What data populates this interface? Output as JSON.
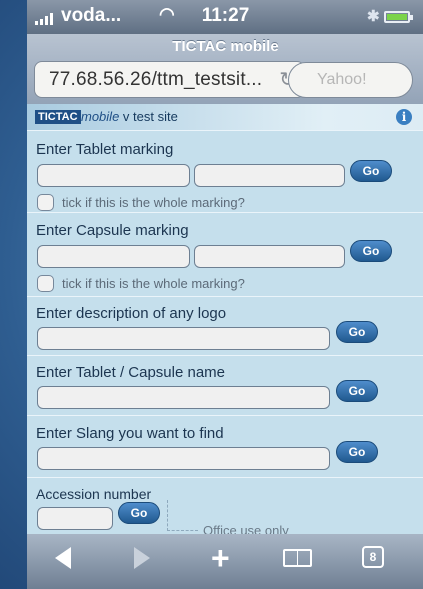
{
  "status_bar": {
    "carrier": "voda...",
    "time": "11:27"
  },
  "browser": {
    "page_title": "TICTAC mobile",
    "url": "77.68.56.26/ttm_testsit...",
    "search_placeholder": "Yahoo!"
  },
  "site_header": {
    "logo": "TICTAC",
    "tagline_em": "mobile",
    "tagline_rest": " v test site",
    "info": "i"
  },
  "sections": {
    "tablet_marking": {
      "label": "Enter Tablet marking",
      "go": "Go",
      "check_label": "tick if this is the whole marking?"
    },
    "capsule_marking": {
      "label": "Enter Capsule marking",
      "go": "Go",
      "check_label": "tick if this is the whole marking?"
    },
    "logo_description": {
      "label": "Enter description of any logo",
      "go": "Go"
    },
    "name": {
      "label": "Enter Tablet / Capsule name",
      "go": "Go"
    },
    "slang": {
      "label": "Enter Slang you want to find",
      "go": "Go"
    },
    "accession": {
      "label": "Accession number",
      "go": "Go",
      "office_note": "Office use only"
    }
  },
  "toolbar": {
    "tabs_count": "8"
  }
}
